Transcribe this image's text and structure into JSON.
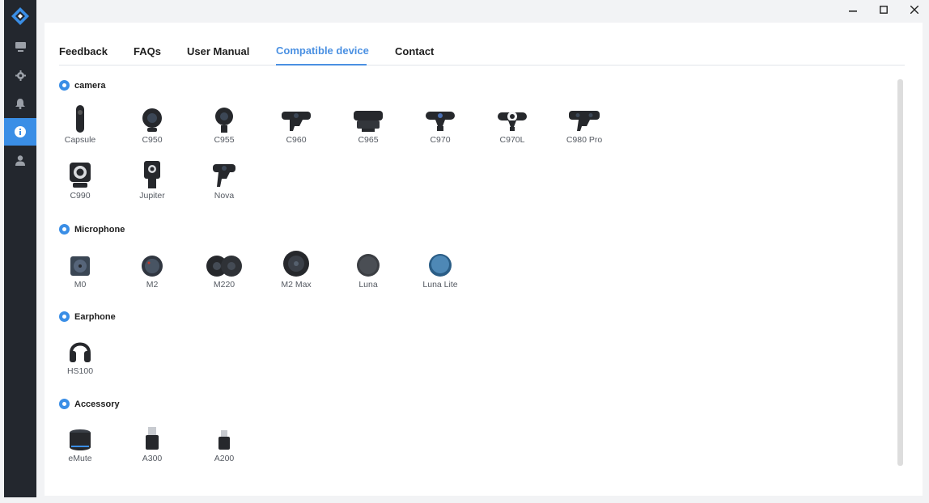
{
  "window": {
    "minimize_icon": "minimize-icon",
    "maximize_icon": "maximize-icon",
    "close_icon": "close-icon"
  },
  "sidebar": {
    "items": [
      {
        "icon": "monitor-icon",
        "active": false
      },
      {
        "icon": "gear-icon",
        "active": false
      },
      {
        "icon": "bell-icon",
        "active": false
      },
      {
        "icon": "info-icon",
        "active": true
      },
      {
        "icon": "user-icon",
        "active": false
      }
    ],
    "accent": "#3a8ee6"
  },
  "tabs": [
    {
      "label": "Feedback",
      "active": false
    },
    {
      "label": "FAQs",
      "active": false
    },
    {
      "label": "User Manual",
      "active": false
    },
    {
      "label": "Compatible device",
      "active": true
    },
    {
      "label": "Contact",
      "active": false
    }
  ],
  "sections": {
    "camera": {
      "title": "camera",
      "devices": [
        "Capsule",
        "C950",
        "C955",
        "C960",
        "C965",
        "C970",
        "C970L",
        "C980 Pro",
        "C990",
        "Jupiter",
        "Nova"
      ]
    },
    "microphone": {
      "title": "Microphone",
      "devices": [
        "M0",
        "M2",
        "M220",
        "M2 Max",
        "Luna",
        "Luna Lite"
      ]
    },
    "earphone": {
      "title": "Earphone",
      "devices": [
        "HS100"
      ]
    },
    "accessory": {
      "title": "Accessory",
      "devices": [
        "eMute",
        "A300",
        "A200"
      ]
    }
  }
}
